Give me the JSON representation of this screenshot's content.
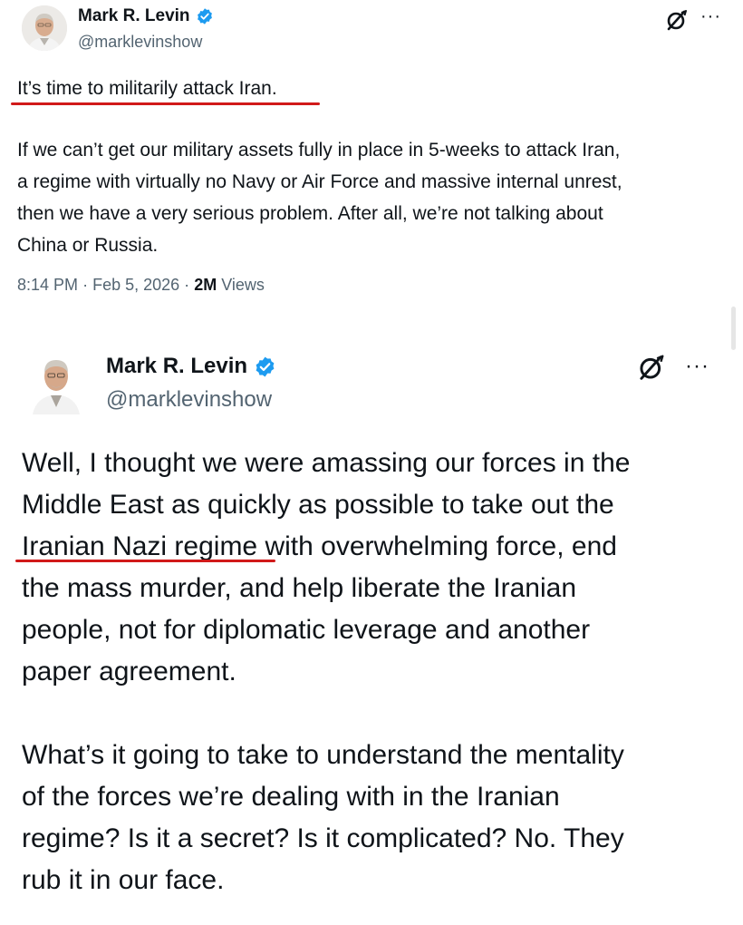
{
  "tweet1": {
    "author_name": "Mark R. Levin",
    "handle": "@marklevinshow",
    "headline": "It’s time to militarily attack Iran.",
    "body_lines": [
      "If we can’t get our military assets fully in place in 5-weeks to attack Iran,",
      "a regime with virtually no Navy or Air Force and massive internal unrest,",
      "then we have a very serious problem.  After all, we’re not talking about",
      "China or Russia."
    ],
    "time": "8:14 PM",
    "date": "Feb 5, 2026",
    "views_count": "2M",
    "views_label": "Views",
    "separator": "·"
  },
  "tweet2": {
    "author_name": "Mark R. Levin",
    "handle": "@marklevinshow",
    "paragraph1_lines": [
      "Well, I thought we were amassing our forces in the",
      "Middle East as quickly as possible to take out the",
      "Iranian Nazi regime with overwhelming force, end",
      "the mass murder, and help liberate the Iranian",
      "people, not for diplomatic leverage and another",
      "paper agreement."
    ],
    "paragraph2_lines": [
      "What’s it going to take to understand the mentality",
      "of the forces we’re dealing with in the Iranian",
      "regime?  Is it a secret?  Is it complicated?  No. They",
      "rub it in our face."
    ]
  },
  "icons": {
    "verified": "verified-badge-icon",
    "grok": "grok-icon",
    "more": "more-options-icon",
    "more_glyph": "···"
  },
  "colors": {
    "text": "#0f1419",
    "secondary": "#536471",
    "verified_blue": "#1d9bf0",
    "highlight_underline": "#d11a1a"
  }
}
